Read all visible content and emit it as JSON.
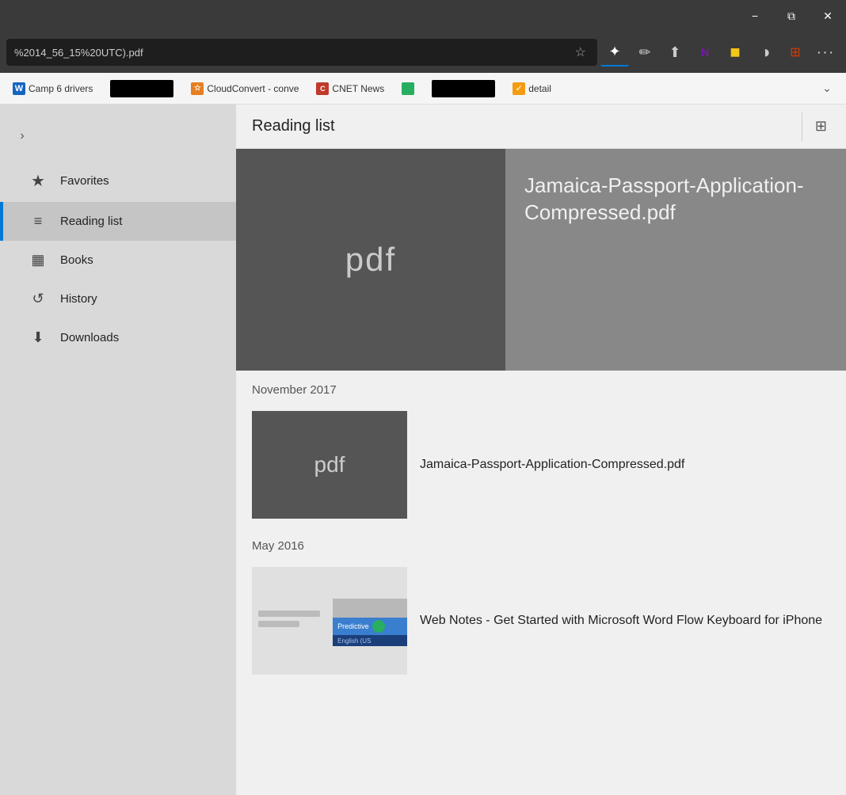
{
  "titlebar": {
    "minimize_label": "−",
    "restore_label": "⧉",
    "close_label": "✕"
  },
  "addressbar": {
    "url": "%2014_56_15%20UTC).pdf",
    "bookmark_icon": "☆",
    "toolbar_icons": [
      {
        "name": "reading-list-icon",
        "symbol": "✦",
        "active": true
      },
      {
        "name": "pen-icon",
        "symbol": "✒"
      },
      {
        "name": "share-icon",
        "symbol": "⬆"
      },
      {
        "name": "onenote-icon",
        "symbol": "N"
      },
      {
        "name": "sticky-icon",
        "symbol": "▪"
      },
      {
        "name": "circle-icon",
        "symbol": "◑"
      },
      {
        "name": "office-icon",
        "symbol": "⊞"
      },
      {
        "name": "more-icon",
        "symbol": "···"
      }
    ]
  },
  "bookmarks_bar": {
    "items": [
      {
        "label": "Camp 6 drivers",
        "favicon_color": "#1565c0",
        "has_icon": true
      },
      {
        "label": "",
        "is_black": true
      },
      {
        "label": "CloudConvert - conve",
        "has_favicon": true
      },
      {
        "label": "CNET News",
        "favicon_color": "#c0392b",
        "has_icon": true
      },
      {
        "label": "",
        "is_green": true
      },
      {
        "label": "",
        "is_black": true
      },
      {
        "label": "detail",
        "favicon_color": "#27ae60",
        "has_icon": true
      }
    ],
    "dropdown_symbol": "⌄"
  },
  "sidebar": {
    "expand_symbol": "›",
    "items": [
      {
        "id": "favorites",
        "label": "Favorites",
        "icon": "★",
        "active": false
      },
      {
        "id": "reading-list",
        "label": "Reading list",
        "icon": "≡",
        "active": true
      },
      {
        "id": "books",
        "label": "Books",
        "icon": "📚",
        "active": false
      },
      {
        "id": "history",
        "label": "History",
        "icon": "↺",
        "active": false
      },
      {
        "id": "downloads",
        "label": "Downloads",
        "icon": "⬇",
        "active": false
      }
    ]
  },
  "reading_list": {
    "title": "Reading list",
    "pin_icon": "⊞",
    "hero": {
      "thumb_label": "pdf",
      "title": "Jamaica-Passport-Application-Compressed.pdf"
    },
    "sections": [
      {
        "month": "November 2017",
        "entries": [
          {
            "thumb_type": "pdf",
            "thumb_label": "pdf",
            "title": "Jamaica-Passport-Application-Compressed.pdf"
          }
        ]
      },
      {
        "month": "May 2016",
        "entries": [
          {
            "thumb_type": "article",
            "title": "Web Notes - Get Started with Microsoft Word Flow Keyboard for iPhone"
          }
        ]
      }
    ]
  }
}
